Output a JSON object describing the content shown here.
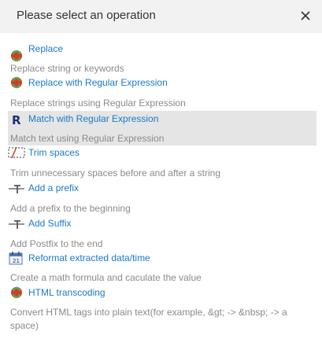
{
  "dialog": {
    "title": "Please select an operation",
    "close_icon": "close-icon"
  },
  "colors": {
    "header_bg": "#f2f2f2",
    "link": "#1a79c9",
    "desc": "#8a8a8a",
    "selected_bg": "#e5e5e5"
  },
  "operations": [
    {
      "label": "Replace",
      "description": "Replace string or keywords",
      "icon": "replace-icon"
    },
    {
      "label": "Replace with Regular Expression",
      "description": "Replace strings using Regular Expression",
      "icon": "replace-regex-icon"
    },
    {
      "label": "Match with Regular Expression",
      "description": "Match text using Regular Expression",
      "icon": "regex-match-icon",
      "selected": true
    },
    {
      "label": "Trim spaces",
      "description": "Trim unnecessary spaces before and after a string",
      "icon": "trim-spaces-icon"
    },
    {
      "label": "Add a prefix",
      "description": "Add a prefix to the beginning",
      "icon": "prefix-icon"
    },
    {
      "label": "Add Suffix",
      "description": "Add Postfix to the end",
      "icon": "suffix-icon"
    },
    {
      "label": "Reformat extracted data/time",
      "description": "Create a math formula and caculate the value",
      "icon": "calendar-icon"
    },
    {
      "label": "HTML transcoding",
      "description": "Convert HTML tags into plain text(for example, &gt; -> &nbsp; -> a space)",
      "icon": "html-transcode-icon"
    }
  ]
}
